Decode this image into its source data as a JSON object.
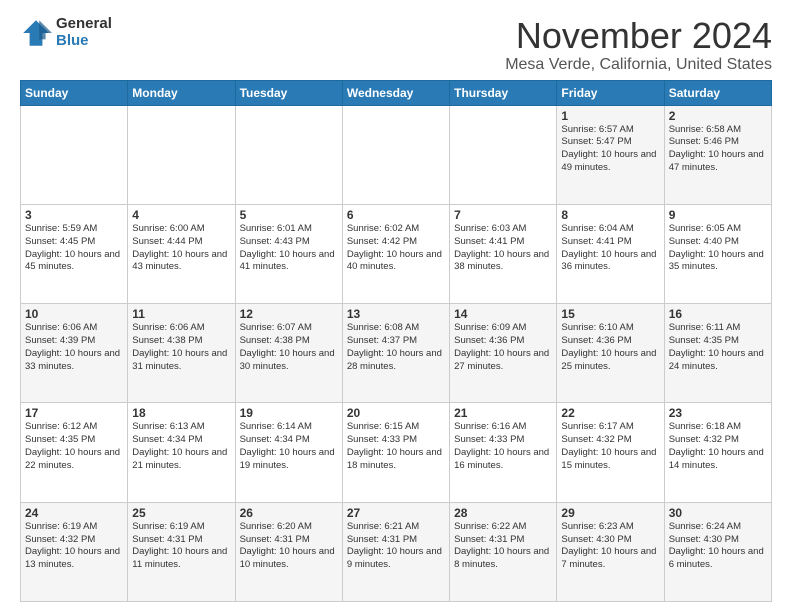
{
  "header": {
    "logo_general": "General",
    "logo_blue": "Blue",
    "title": "November 2024",
    "location": "Mesa Verde, California, United States"
  },
  "weekdays": [
    "Sunday",
    "Monday",
    "Tuesday",
    "Wednesday",
    "Thursday",
    "Friday",
    "Saturday"
  ],
  "weeks": [
    [
      {
        "day": "",
        "info": ""
      },
      {
        "day": "",
        "info": ""
      },
      {
        "day": "",
        "info": ""
      },
      {
        "day": "",
        "info": ""
      },
      {
        "day": "",
        "info": ""
      },
      {
        "day": "1",
        "info": "Sunrise: 6:57 AM\nSunset: 5:47 PM\nDaylight: 10 hours and 49 minutes."
      },
      {
        "day": "2",
        "info": "Sunrise: 6:58 AM\nSunset: 5:46 PM\nDaylight: 10 hours and 47 minutes."
      }
    ],
    [
      {
        "day": "3",
        "info": "Sunrise: 5:59 AM\nSunset: 4:45 PM\nDaylight: 10 hours and 45 minutes."
      },
      {
        "day": "4",
        "info": "Sunrise: 6:00 AM\nSunset: 4:44 PM\nDaylight: 10 hours and 43 minutes."
      },
      {
        "day": "5",
        "info": "Sunrise: 6:01 AM\nSunset: 4:43 PM\nDaylight: 10 hours and 41 minutes."
      },
      {
        "day": "6",
        "info": "Sunrise: 6:02 AM\nSunset: 4:42 PM\nDaylight: 10 hours and 40 minutes."
      },
      {
        "day": "7",
        "info": "Sunrise: 6:03 AM\nSunset: 4:41 PM\nDaylight: 10 hours and 38 minutes."
      },
      {
        "day": "8",
        "info": "Sunrise: 6:04 AM\nSunset: 4:41 PM\nDaylight: 10 hours and 36 minutes."
      },
      {
        "day": "9",
        "info": "Sunrise: 6:05 AM\nSunset: 4:40 PM\nDaylight: 10 hours and 35 minutes."
      }
    ],
    [
      {
        "day": "10",
        "info": "Sunrise: 6:06 AM\nSunset: 4:39 PM\nDaylight: 10 hours and 33 minutes."
      },
      {
        "day": "11",
        "info": "Sunrise: 6:06 AM\nSunset: 4:38 PM\nDaylight: 10 hours and 31 minutes."
      },
      {
        "day": "12",
        "info": "Sunrise: 6:07 AM\nSunset: 4:38 PM\nDaylight: 10 hours and 30 minutes."
      },
      {
        "day": "13",
        "info": "Sunrise: 6:08 AM\nSunset: 4:37 PM\nDaylight: 10 hours and 28 minutes."
      },
      {
        "day": "14",
        "info": "Sunrise: 6:09 AM\nSunset: 4:36 PM\nDaylight: 10 hours and 27 minutes."
      },
      {
        "day": "15",
        "info": "Sunrise: 6:10 AM\nSunset: 4:36 PM\nDaylight: 10 hours and 25 minutes."
      },
      {
        "day": "16",
        "info": "Sunrise: 6:11 AM\nSunset: 4:35 PM\nDaylight: 10 hours and 24 minutes."
      }
    ],
    [
      {
        "day": "17",
        "info": "Sunrise: 6:12 AM\nSunset: 4:35 PM\nDaylight: 10 hours and 22 minutes."
      },
      {
        "day": "18",
        "info": "Sunrise: 6:13 AM\nSunset: 4:34 PM\nDaylight: 10 hours and 21 minutes."
      },
      {
        "day": "19",
        "info": "Sunrise: 6:14 AM\nSunset: 4:34 PM\nDaylight: 10 hours and 19 minutes."
      },
      {
        "day": "20",
        "info": "Sunrise: 6:15 AM\nSunset: 4:33 PM\nDaylight: 10 hours and 18 minutes."
      },
      {
        "day": "21",
        "info": "Sunrise: 6:16 AM\nSunset: 4:33 PM\nDaylight: 10 hours and 16 minutes."
      },
      {
        "day": "22",
        "info": "Sunrise: 6:17 AM\nSunset: 4:32 PM\nDaylight: 10 hours and 15 minutes."
      },
      {
        "day": "23",
        "info": "Sunrise: 6:18 AM\nSunset: 4:32 PM\nDaylight: 10 hours and 14 minutes."
      }
    ],
    [
      {
        "day": "24",
        "info": "Sunrise: 6:19 AM\nSunset: 4:32 PM\nDaylight: 10 hours and 13 minutes."
      },
      {
        "day": "25",
        "info": "Sunrise: 6:19 AM\nSunset: 4:31 PM\nDaylight: 10 hours and 11 minutes."
      },
      {
        "day": "26",
        "info": "Sunrise: 6:20 AM\nSunset: 4:31 PM\nDaylight: 10 hours and 10 minutes."
      },
      {
        "day": "27",
        "info": "Sunrise: 6:21 AM\nSunset: 4:31 PM\nDaylight: 10 hours and 9 minutes."
      },
      {
        "day": "28",
        "info": "Sunrise: 6:22 AM\nSunset: 4:31 PM\nDaylight: 10 hours and 8 minutes."
      },
      {
        "day": "29",
        "info": "Sunrise: 6:23 AM\nSunset: 4:30 PM\nDaylight: 10 hours and 7 minutes."
      },
      {
        "day": "30",
        "info": "Sunrise: 6:24 AM\nSunset: 4:30 PM\nDaylight: 10 hours and 6 minutes."
      }
    ]
  ]
}
